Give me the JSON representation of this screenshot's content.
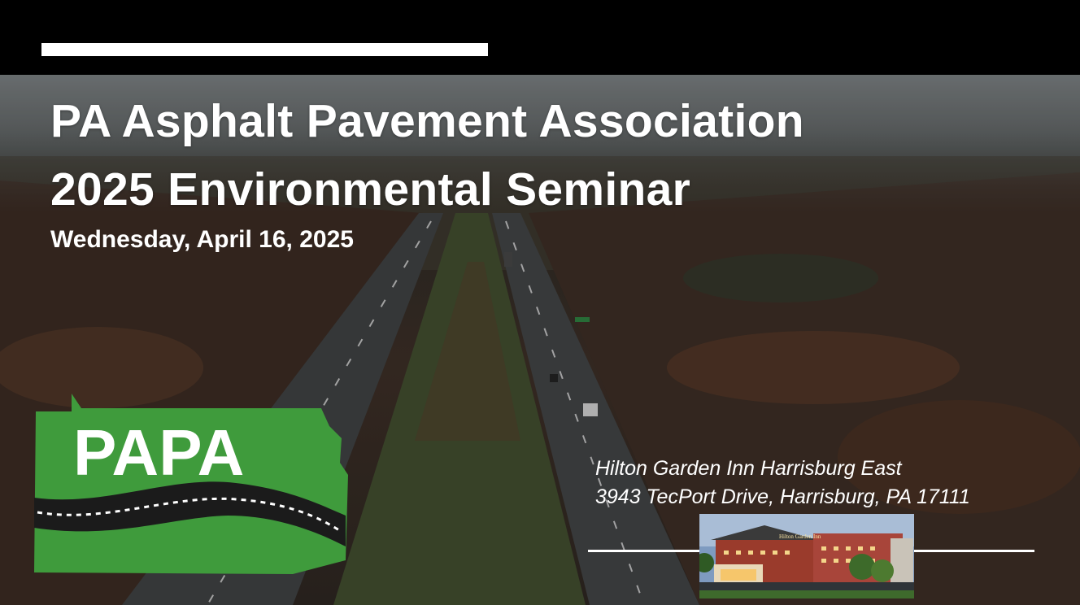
{
  "slide": {
    "title_line1": "PA Asphalt Pavement Association",
    "title_line2": "2025 Environmental Seminar",
    "date": "Wednesday, April 16, 2025",
    "venue_name": "Hilton Garden Inn Harrisburg East",
    "venue_address": "3943 TecPort Drive, Harrisburg, PA 17111"
  },
  "logo": {
    "text": "PAPA",
    "color": "#3f9b3c"
  },
  "hotel_photo": {
    "sign_text": "Hilton Garden Inn"
  },
  "colors": {
    "text": "#ffffff",
    "topbar": "#000000"
  }
}
